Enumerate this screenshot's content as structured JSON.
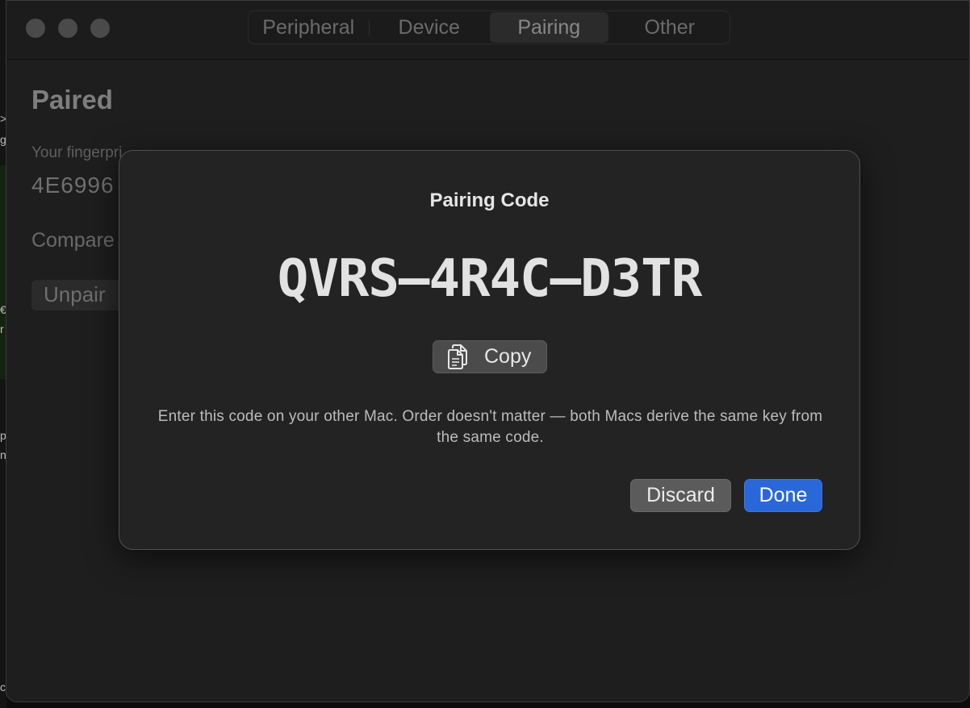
{
  "background_window": {
    "edge_text": [
      ">",
      "g",
      "€",
      "r",
      "p",
      "n",
      "c"
    ]
  },
  "window": {
    "tabs": [
      {
        "label": "Peripheral",
        "active": false
      },
      {
        "label": "Device",
        "active": false
      },
      {
        "label": "Pairing",
        "active": true
      },
      {
        "label": "Other",
        "active": false
      }
    ],
    "content": {
      "title": "Paired",
      "fingerprint_label": "Your fingerpri",
      "fingerprint_value": "4E6996",
      "compare_text": "Compare",
      "unpair_label": "Unpair"
    }
  },
  "sheet": {
    "title": "Pairing Code",
    "code": "QVRS–4R4C–D3TR",
    "copy_label": "Copy",
    "instructions": "Enter this code on your other Mac. Order doesn't matter — both Macs derive the same key from the same code.",
    "discard_label": "Discard",
    "done_label": "Done"
  },
  "colors": {
    "accent": "#2a67d8",
    "sheet_background": "#232323",
    "window_background": "#1e1e1e"
  },
  "icons": {
    "copy": "doc-on-doc-icon"
  }
}
